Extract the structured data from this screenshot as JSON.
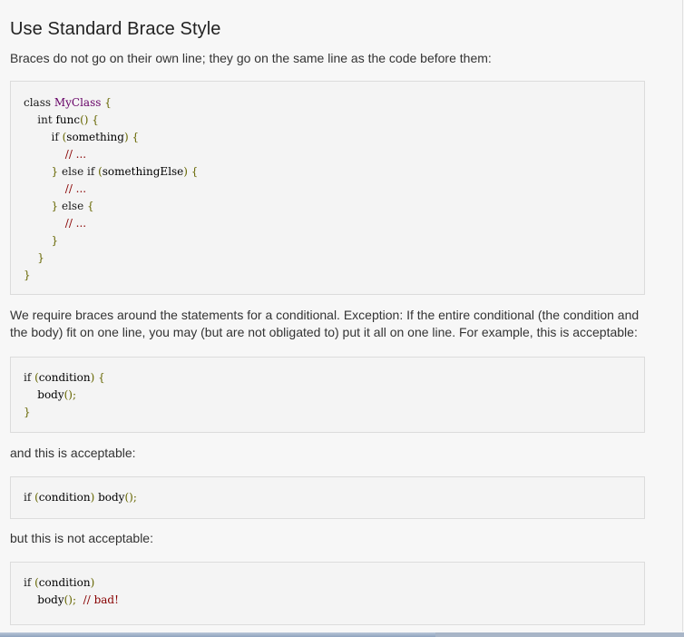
{
  "heading": "Use Standard Brace Style",
  "intro": "Braces do not go on their own line; they go on the same line as the code before them:",
  "code1": [
    [
      [
        "kw",
        "class "
      ],
      [
        "typ",
        "MyClass"
      ],
      [
        "pun",
        " {"
      ]
    ],
    [
      [
        "pln",
        "    "
      ],
      [
        "kw",
        "int "
      ],
      [
        "pln",
        "func"
      ],
      [
        "pun",
        "() {"
      ]
    ],
    [
      [
        "pln",
        "        "
      ],
      [
        "kw",
        "if "
      ],
      [
        "pun",
        "("
      ],
      [
        "pln",
        "something"
      ],
      [
        "pun",
        ") {"
      ]
    ],
    [
      [
        "pln",
        "            "
      ],
      [
        "com",
        "// ..."
      ]
    ],
    [
      [
        "pln",
        "        "
      ],
      [
        "pun",
        "} "
      ],
      [
        "kw",
        "else if "
      ],
      [
        "pun",
        "("
      ],
      [
        "pln",
        "somethingElse"
      ],
      [
        "pun",
        ") {"
      ]
    ],
    [
      [
        "pln",
        "            "
      ],
      [
        "com",
        "// ..."
      ]
    ],
    [
      [
        "pln",
        "        "
      ],
      [
        "pun",
        "} "
      ],
      [
        "kw",
        "else "
      ],
      [
        "pun",
        "{"
      ]
    ],
    [
      [
        "pln",
        "            "
      ],
      [
        "com",
        "// ..."
      ]
    ],
    [
      [
        "pln",
        "        "
      ],
      [
        "pun",
        "}"
      ]
    ],
    [
      [
        "pln",
        "    "
      ],
      [
        "pun",
        "}"
      ]
    ],
    [
      [
        "pun",
        "}"
      ]
    ]
  ],
  "paragraph2": "We require braces around the statements for a conditional. Exception: If the entire conditional (the condition and the body) fit on one line, you may (but are not obligated to) put it all on one line. For example, this is acceptable:",
  "code2": [
    [
      [
        "kw",
        "if "
      ],
      [
        "pun",
        "("
      ],
      [
        "pln",
        "condition"
      ],
      [
        "pun",
        ") {"
      ]
    ],
    [
      [
        "pln",
        "    body"
      ],
      [
        "pun",
        "();"
      ]
    ],
    [
      [
        "pun",
        "}"
      ]
    ]
  ],
  "paragraph3": "and this is acceptable:",
  "code3": [
    [
      [
        "kw",
        "if "
      ],
      [
        "pun",
        "("
      ],
      [
        "pln",
        "condition"
      ],
      [
        "pun",
        ") "
      ],
      [
        "pln",
        "body"
      ],
      [
        "pun",
        "();"
      ]
    ]
  ],
  "paragraph4": "but this is not acceptable:",
  "code4": [
    [
      [
        "kw",
        "if "
      ],
      [
        "pun",
        "("
      ],
      [
        "pln",
        "condition"
      ],
      [
        "pun",
        ")"
      ]
    ],
    [
      [
        "pln",
        "    body"
      ],
      [
        "pun",
        "();  "
      ],
      [
        "com",
        "// bad!"
      ]
    ]
  ]
}
